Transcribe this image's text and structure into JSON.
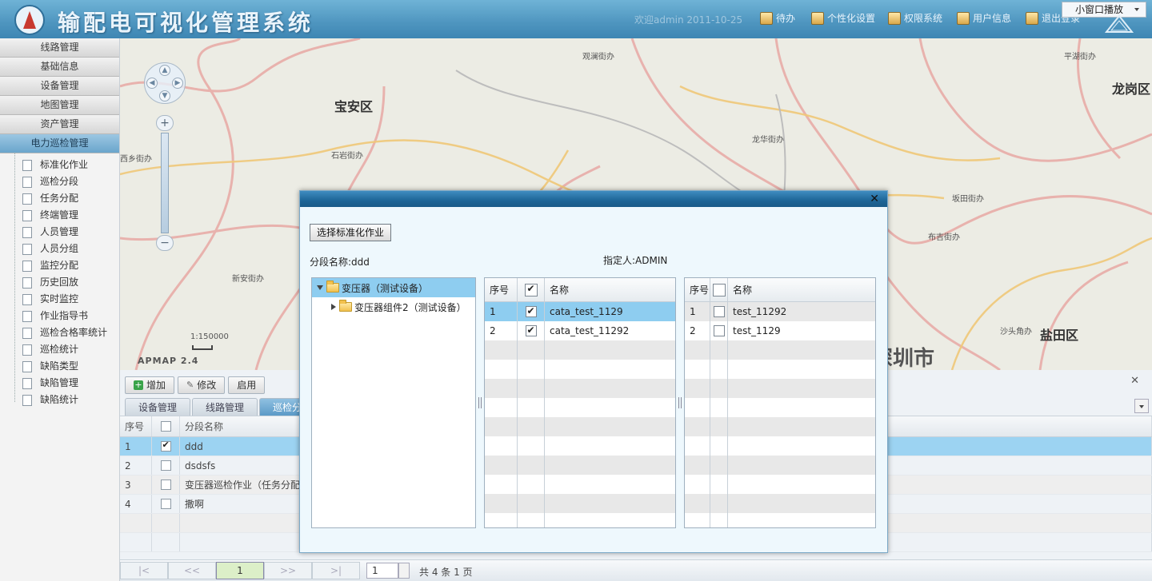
{
  "header": {
    "title": "输配电可视化管理系统",
    "user_time": "欢迎admin 2011-10-25",
    "nav": [
      {
        "label": "待办",
        "icon": "todo-icon"
      },
      {
        "label": "个性化设置",
        "icon": "settings-icon"
      },
      {
        "label": "权限系统",
        "icon": "permission-icon"
      },
      {
        "label": "用户信息",
        "icon": "user-info-icon"
      },
      {
        "label": "退出登录",
        "icon": "logout-icon"
      }
    ],
    "small_window": "小窗口播放"
  },
  "sidebar": {
    "menus": [
      "线路管理",
      "基础信息",
      "设备管理",
      "地图管理",
      "资产管理",
      "电力巡检管理"
    ],
    "sub_items": [
      "标准化作业",
      "巡检分段",
      "任务分配",
      "终端管理",
      "人员管理",
      "人员分组",
      "监控分配",
      "历史回放",
      "实时监控",
      "作业指导书",
      "巡检合格率统计",
      "巡检统计",
      "缺陷类型",
      "缺陷管理",
      "缺陷统计"
    ]
  },
  "map": {
    "labels": [
      {
        "text": "宝安区",
        "type": "district"
      },
      {
        "text": "盐田区",
        "type": "district"
      },
      {
        "text": "深圳市",
        "type": "city"
      },
      {
        "text": "龙岗区",
        "type": "district"
      },
      {
        "text": "石岩街办",
        "type": "small"
      },
      {
        "text": "观澜街办",
        "type": "small"
      },
      {
        "text": "平湖街办",
        "type": "small"
      },
      {
        "text": "布吉街办",
        "type": "small"
      },
      {
        "text": "沙头角办",
        "type": "small"
      },
      {
        "text": "新安街办",
        "type": "small"
      },
      {
        "text": "西乡街办",
        "type": "small"
      },
      {
        "text": "龙华街办",
        "type": "small"
      },
      {
        "text": "坂田街办",
        "type": "small"
      }
    ],
    "scale": "1:150000",
    "brand": "APMAP 2.4"
  },
  "bottom": {
    "toolbar": [
      "增加",
      "修改",
      "启用"
    ],
    "tabs": [
      "设备管理",
      "线路管理",
      "巡检分段"
    ],
    "columns": {
      "no": "序号",
      "name": "分段名称"
    },
    "rows": [
      {
        "no": "1",
        "name": "ddd",
        "checked": true
      },
      {
        "no": "2",
        "name": "dsdsfs",
        "checked": false
      },
      {
        "no": "3",
        "name": "变压器巡检作业（任务分配",
        "checked": false
      },
      {
        "no": "4",
        "name": "撒啊",
        "checked": false
      }
    ],
    "pager": {
      "first": "|<",
      "prev": "<<",
      "current": "1",
      "next": ">>",
      "last": ">|",
      "input": "1",
      "total": "共 4 条 1 页"
    }
  },
  "dialog": {
    "select_button": "选择标准化作业",
    "segment_label": "分段名称:ddd",
    "assignee_label": "指定人:ADMIN",
    "tree": [
      {
        "label": "变压器（测试设备）",
        "expanded": true,
        "level": 0
      },
      {
        "label": "变压器组件2（测试设备）",
        "expanded": false,
        "level": 1
      }
    ],
    "left_grid": {
      "col_no": "序号",
      "col_name": "名称",
      "rows": [
        {
          "no": "1",
          "name": "cata_test_1129",
          "checked": true
        },
        {
          "no": "2",
          "name": "cata_test_11292",
          "checked": true
        }
      ]
    },
    "right_grid": {
      "col_no": "序号",
      "col_name": "名称",
      "rows": [
        {
          "no": "1",
          "name": "test_11292",
          "checked": false
        },
        {
          "no": "2",
          "name": "test_1129",
          "checked": false
        }
      ]
    }
  }
}
